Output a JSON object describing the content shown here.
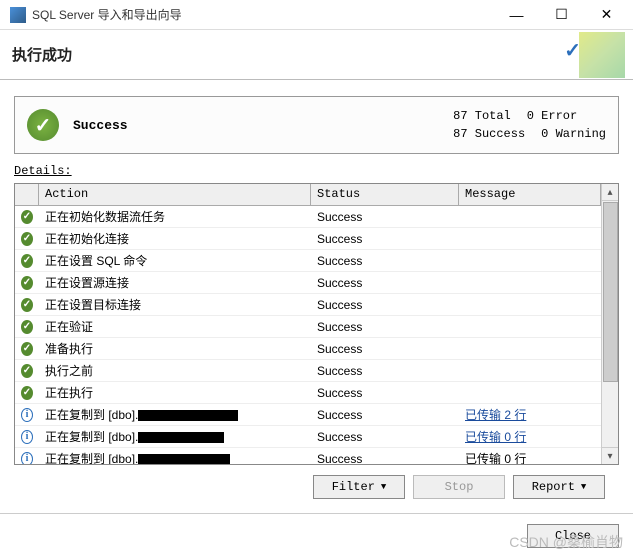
{
  "title": "SQL Server 导入和导出向导",
  "header": {
    "title": "执行成功"
  },
  "summary": {
    "label": "Success",
    "stats": {
      "total_n": "87",
      "total_l": "Total",
      "error_n": "0",
      "error_l": "Error",
      "success_n": "87",
      "success_l": "Success",
      "warn_n": "0",
      "warn_l": "Warning"
    }
  },
  "details_label": "Details:",
  "columns": {
    "action": "Action",
    "status": "Status",
    "message": "Message"
  },
  "rows": [
    {
      "icon": "ok",
      "action": "正在初始化数据流任务",
      "status": "Success",
      "message": ""
    },
    {
      "icon": "ok",
      "action": "正在初始化连接",
      "status": "Success",
      "message": ""
    },
    {
      "icon": "ok",
      "action": "正在设置 SQL 命令",
      "status": "Success",
      "message": ""
    },
    {
      "icon": "ok",
      "action": "正在设置源连接",
      "status": "Success",
      "message": ""
    },
    {
      "icon": "ok",
      "action": "正在设置目标连接",
      "status": "Success",
      "message": ""
    },
    {
      "icon": "ok",
      "action": "正在验证",
      "status": "Success",
      "message": ""
    },
    {
      "icon": "ok",
      "action": "准备执行",
      "status": "Success",
      "message": ""
    },
    {
      "icon": "ok",
      "action": "执行之前",
      "status": "Success",
      "message": ""
    },
    {
      "icon": "ok",
      "action": "正在执行",
      "status": "Success",
      "message": ""
    },
    {
      "icon": "info",
      "action_prefix": "正在复制到 [dbo].",
      "redact_w": 100,
      "status": "Success",
      "message": "已传输 2 行",
      "link": true
    },
    {
      "icon": "info",
      "action_prefix": "正在复制到 [dbo].",
      "redact_w": 86,
      "status": "Success",
      "message": "已传输 0 行",
      "link": true
    },
    {
      "icon": "info",
      "action_prefix": "正在复制到 [dbo].",
      "redact_w": 92,
      "status": "Success",
      "message": "已传输 0 行",
      "link": false
    }
  ],
  "buttons": {
    "filter": "Filter",
    "stop": "Stop",
    "report": "Report",
    "close": "Close"
  },
  "watermark": "CSDN @桑榆肖物"
}
